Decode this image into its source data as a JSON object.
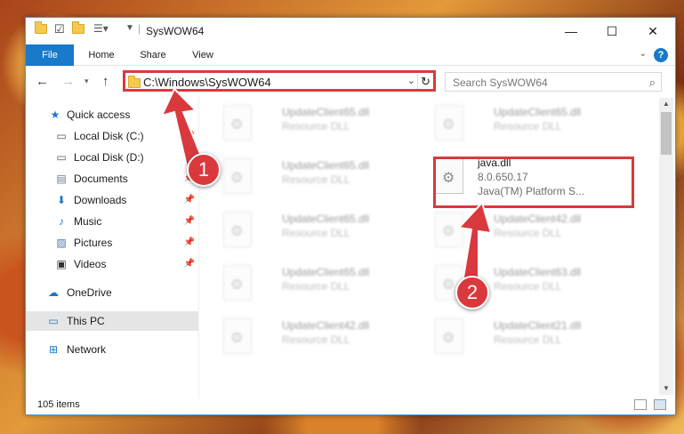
{
  "window": {
    "title": "SysWOW64",
    "controls": {
      "minimize": "—",
      "maximize": "☐",
      "close": "✕"
    }
  },
  "ribbon": {
    "tabs": [
      "File",
      "Home",
      "Share",
      "View"
    ],
    "help": "?"
  },
  "address_bar": {
    "path": "C:\\Windows\\SysWOW64",
    "search_placeholder": "Search SysWOW64"
  },
  "sidebar": {
    "items": [
      {
        "label": "Quick access",
        "icon": "star-icon",
        "pinned": false
      },
      {
        "label": "Local Disk (C:)",
        "icon": "drive-icon",
        "pinned": true
      },
      {
        "label": "Local Disk (D:)",
        "icon": "drive-icon",
        "pinned": true
      },
      {
        "label": "Documents",
        "icon": "documents-icon",
        "pinned": true
      },
      {
        "label": "Downloads",
        "icon": "download-icon",
        "pinned": true
      },
      {
        "label": "Music",
        "icon": "music-icon",
        "pinned": true
      },
      {
        "label": "Pictures",
        "icon": "pictures-icon",
        "pinned": true
      },
      {
        "label": "Videos",
        "icon": "videos-icon",
        "pinned": true
      },
      {
        "label": "OneDrive",
        "icon": "cloud-icon",
        "pinned": false
      },
      {
        "label": "This PC",
        "icon": "computer-icon",
        "pinned": false,
        "selected": true
      },
      {
        "label": "Network",
        "icon": "network-icon",
        "pinned": false
      }
    ]
  },
  "files": [
    {
      "name": "UpdateClient65.dll",
      "desc": "Resource DLL"
    },
    {
      "name": "UpdateClient65.dll",
      "desc": "Resource DLL"
    },
    {
      "name": "UpdateClient65.dll",
      "desc": "Resource DLL"
    },
    {
      "name": "java.dll",
      "version": "8.0.650.17",
      "product": "Java(TM) Platform S..."
    },
    {
      "name": "UpdateClient65.dll",
      "desc": "Resource DLL"
    },
    {
      "name": "UpdateClient42.dll",
      "desc": "Resource DLL"
    },
    {
      "name": "UpdateClient65.dll",
      "desc": "Resource DLL"
    },
    {
      "name": "UpdateClient63.dll",
      "desc": "Resource DLL"
    },
    {
      "name": "UpdateClient42.dll",
      "desc": "Resource DLL"
    },
    {
      "name": "UpdateClient21.dll",
      "desc": "Resource DLL"
    }
  ],
  "status": {
    "item_count": "105 items"
  },
  "annotations": {
    "step1": "1",
    "step2": "2",
    "color": "#d9393d"
  }
}
